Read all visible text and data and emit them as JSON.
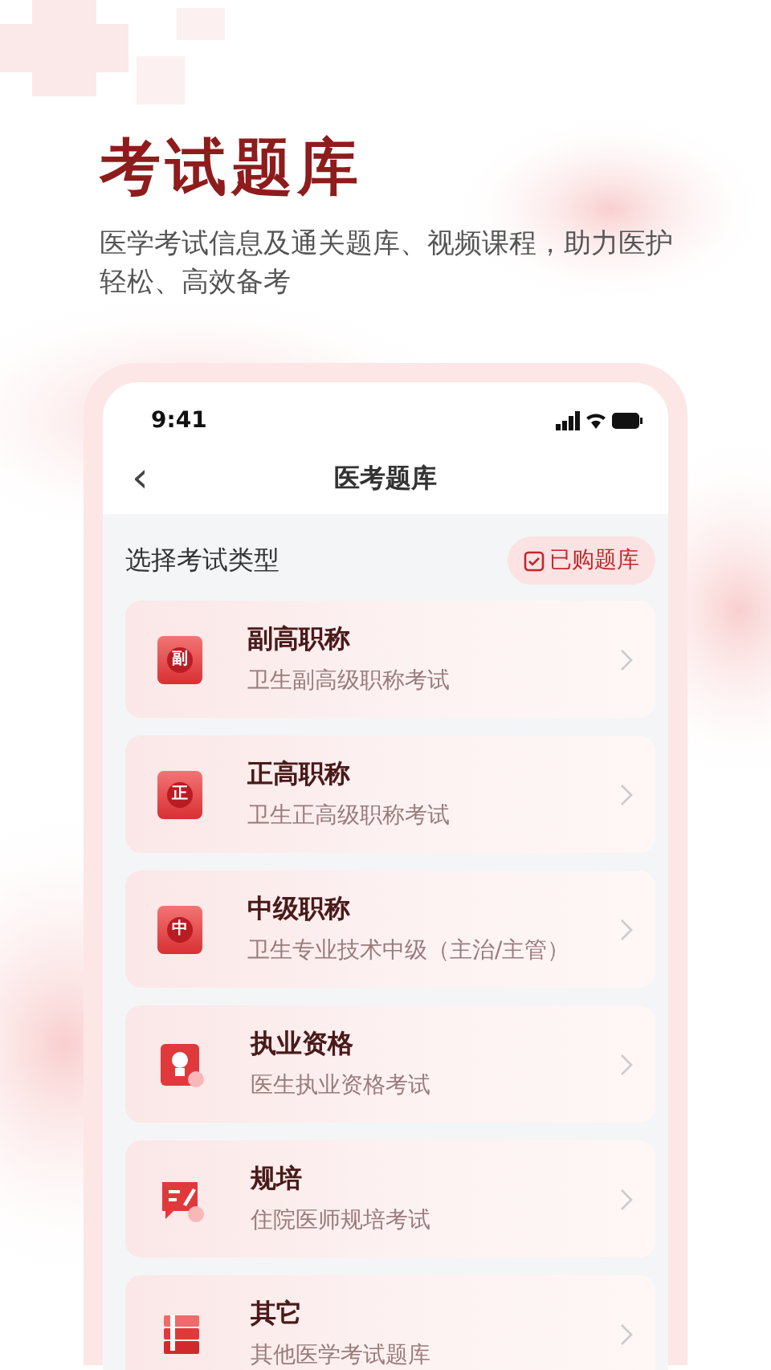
{
  "hero": {
    "title": "考试题库",
    "subtitle": "医学考试信息及通关题库、视频课程，助力医护轻松、高效备考"
  },
  "phone": {
    "status_bar": {
      "time": "9:41"
    },
    "nav": {
      "back": "‹",
      "title": "医考题库"
    },
    "section": {
      "title": "选择考试类型",
      "purchased_button": "已购题库"
    },
    "items": [
      {
        "kind": "medal",
        "icon_char": "副",
        "title": "副高职称",
        "subtitle": "卫生副高级职称考试"
      },
      {
        "kind": "medal",
        "icon_char": "正",
        "title": "正高职称",
        "subtitle": "卫生正高级职称考试"
      },
      {
        "kind": "medal",
        "icon_char": "中",
        "title": "中级职称",
        "subtitle": "卫生专业技术中级（主治/主管）"
      },
      {
        "kind": "certificate",
        "title": "执业资格",
        "subtitle": "医生执业资格考试"
      },
      {
        "kind": "chat",
        "title": "规培",
        "subtitle": "住院医师规培考试"
      },
      {
        "kind": "books",
        "title": "其它",
        "subtitle": "其他医学考试题库"
      }
    ]
  }
}
